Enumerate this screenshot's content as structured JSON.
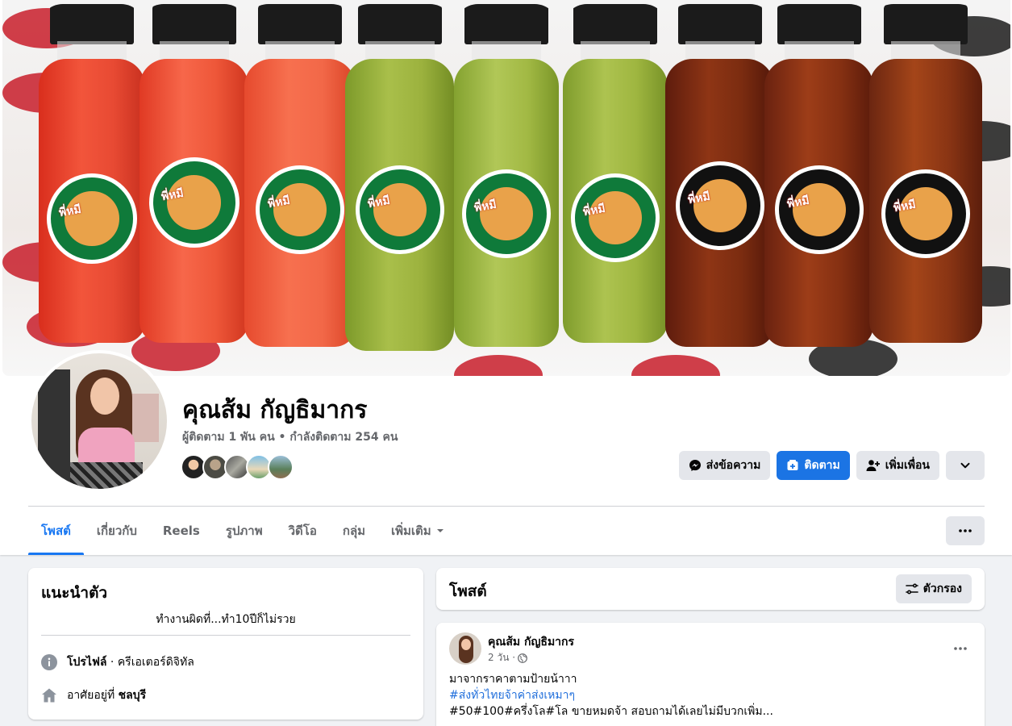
{
  "profile": {
    "name": "คุณส้ม กัญธิมากร",
    "stats": "ผู้ติดตาม 1 พัน คน • กำลังติดตาม 254 คน"
  },
  "actions": {
    "message_label": "ส่งข้อความ",
    "follow_label": "ติดตาม",
    "add_friend_label": "เพิ่มเพื่อน"
  },
  "tabs": [
    {
      "label": "โพสต์"
    },
    {
      "label": "เกี่ยวกับ"
    },
    {
      "label": "Reels"
    },
    {
      "label": "รูปภาพ"
    },
    {
      "label": "วิดีโอ"
    },
    {
      "label": "กลุ่ม"
    },
    {
      "label": "เพิ่มเติม"
    }
  ],
  "intro": {
    "title": "แนะนำตัว",
    "bio": "ทำงานผิดที่...ทำ10ปีก็ไม่รวย",
    "profile_label": "โปรไฟล์",
    "profile_category": " · ครีเอเตอร์ดิจิทัล",
    "lives_prefix": "อาศัยอยู่ที่ ",
    "lives_city": "ชลบุรี"
  },
  "posts_section": {
    "title": "โพสต์",
    "filter_label": "ตัวกรอง"
  },
  "post": {
    "author": "คุณส้ม กัญธิมากร",
    "time": "2 วัน ·",
    "line1": "มาจากราคาตามป้ายน้าาา",
    "line2": "#ส่งทั่วไทยจ้าค่าส่งเหมาๆ",
    "line3": "#50#100#ครึ่งโล#โล ขายหมดจ้า สอบถามได้เลยไม่มีบวกเพิ่ม..."
  },
  "colors": {
    "accent": "#1877f2",
    "follow_button": "#1b74e4",
    "secondary_text": "#65676b",
    "page_bg": "#f0f2f5"
  }
}
